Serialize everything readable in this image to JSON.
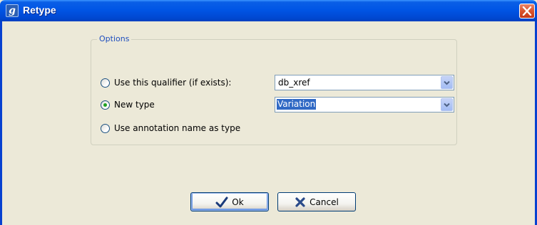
{
  "window": {
    "title": "Retype",
    "app_icon_glyph": "g",
    "close_icon": "close-icon"
  },
  "options": {
    "legend": "Options",
    "radios": [
      {
        "label": "Use this qualifier (if exists):",
        "checked": false
      },
      {
        "label": "New type",
        "checked": true
      },
      {
        "label": "Use annotation name as type",
        "checked": false
      }
    ],
    "qualifier_combo": {
      "value": "db_xref"
    },
    "type_combo": {
      "value": "Variation"
    }
  },
  "buttons": {
    "ok_label": "Ok",
    "cancel_label": "Cancel"
  },
  "colors": {
    "titlebar": "#0055e5",
    "legend_text": "#1f4fbf",
    "selection": "#316ac5",
    "ok_check": "#1a3a7a",
    "cancel_x": "#2a4a8a"
  }
}
